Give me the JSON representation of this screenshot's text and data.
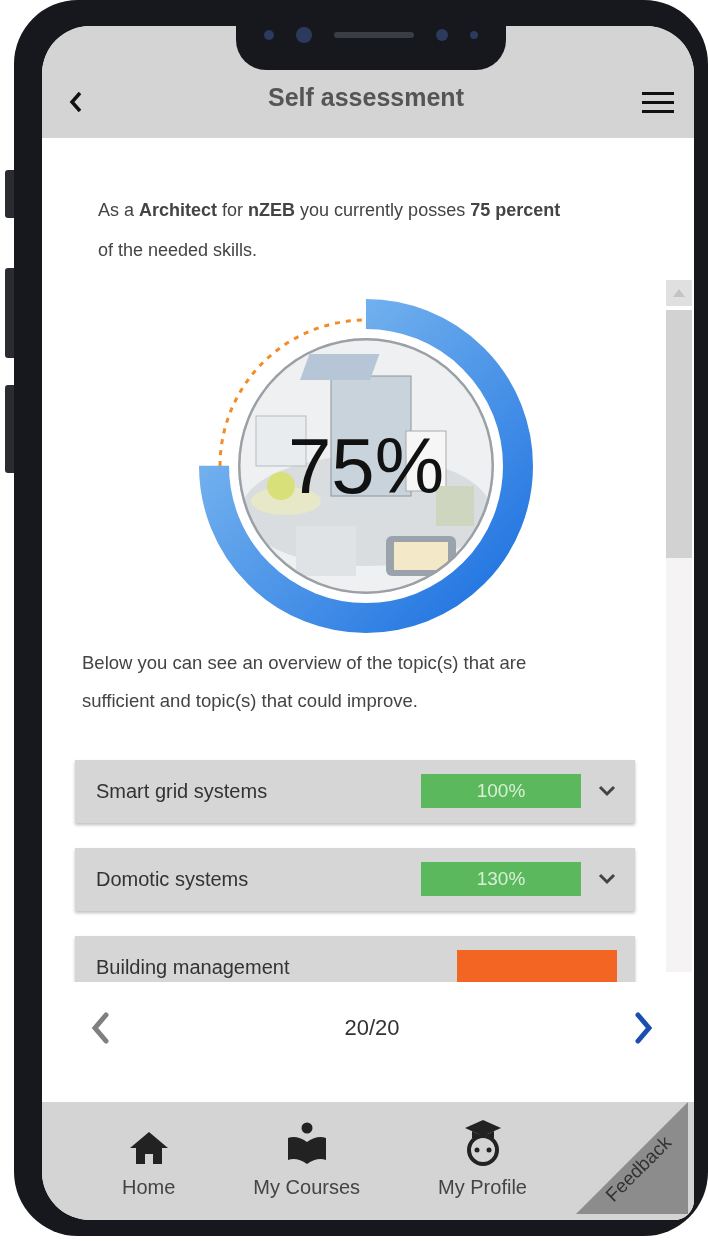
{
  "header": {
    "title": "Self assessment"
  },
  "intro": "As a **Architect** for **nZEB** you currently posses **75** **percent** of the needed skills.",
  "gauge": {
    "label": "75%",
    "level": 0.75
  },
  "overview": "Below you can see an overview of the topic(s) that are sufficient and topic(s) that could improve.",
  "topics": [
    {
      "name": "Smart grid systems",
      "value": "100%",
      "color": "#5cb85c",
      "expanded": false
    },
    {
      "name": "Domotic systems",
      "value": "130%",
      "color": "#5cb85c",
      "expanded": false
    },
    {
      "name": "Building management",
      "color": "#f26522"
    }
  ],
  "pager": {
    "page": "20/20",
    "previous_disabled": true,
    "next_disabled": false
  },
  "nav": [
    {
      "label": "Home"
    },
    {
      "label": "My Courses"
    },
    {
      "label": "My Profile"
    }
  ],
  "feedback": "Feedback"
}
